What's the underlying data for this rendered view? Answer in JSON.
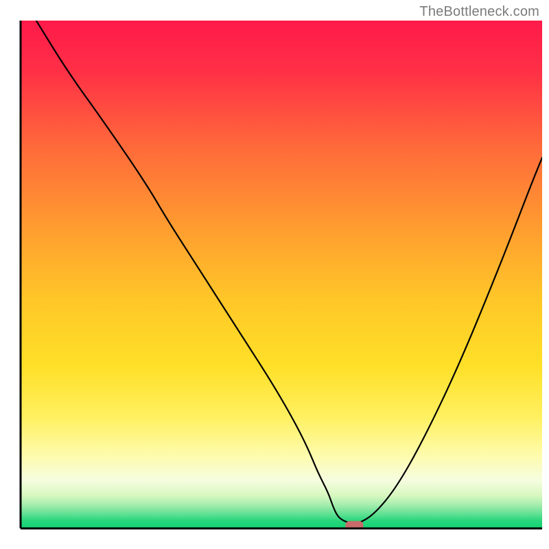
{
  "watermark": "TheBottleneck.com",
  "chart_data": {
    "type": "line",
    "title": "",
    "xlabel": "",
    "ylabel": "",
    "xlim": [
      0,
      100
    ],
    "ylim": [
      0,
      100
    ],
    "annotations": [],
    "background": {
      "type": "vertical_gradient",
      "stops": [
        {
          "offset": 0.0,
          "color": "#ff1a4a"
        },
        {
          "offset": 0.1,
          "color": "#ff3046"
        },
        {
          "offset": 0.25,
          "color": "#ff6a3a"
        },
        {
          "offset": 0.4,
          "color": "#ff9a30"
        },
        {
          "offset": 0.55,
          "color": "#ffc728"
        },
        {
          "offset": 0.68,
          "color": "#ffe028"
        },
        {
          "offset": 0.78,
          "color": "#fff060"
        },
        {
          "offset": 0.86,
          "color": "#fdfcb0"
        },
        {
          "offset": 0.905,
          "color": "#f6fde0"
        },
        {
          "offset": 0.935,
          "color": "#d8f8c0"
        },
        {
          "offset": 0.955,
          "color": "#a0ecac"
        },
        {
          "offset": 0.972,
          "color": "#5fe092"
        },
        {
          "offset": 0.985,
          "color": "#28d67c"
        },
        {
          "offset": 1.0,
          "color": "#12d272"
        }
      ]
    },
    "series": [
      {
        "name": "bottleneck_curve",
        "x": [
          3,
          9,
          16,
          24,
          28,
          33,
          38,
          43,
          48,
          52,
          55,
          57,
          59,
          60,
          61,
          63,
          65,
          68,
          72,
          77,
          84,
          92,
          98,
          100
        ],
        "y": [
          100,
          90,
          80,
          68,
          61,
          53,
          45,
          37,
          29,
          22,
          16,
          11,
          7,
          4,
          2,
          1,
          1,
          3,
          8,
          17,
          32,
          52,
          68,
          73
        ]
      }
    ],
    "marker": {
      "name": "optimal_point",
      "x": 64,
      "y": 0.5,
      "color": "#c96b6b",
      "shape": "rounded_rect"
    },
    "axes": {
      "show_ticks": false,
      "left_border": true,
      "bottom_border": true,
      "right_border": false,
      "top_border": false,
      "border_color": "#000000",
      "border_width": 3
    }
  }
}
